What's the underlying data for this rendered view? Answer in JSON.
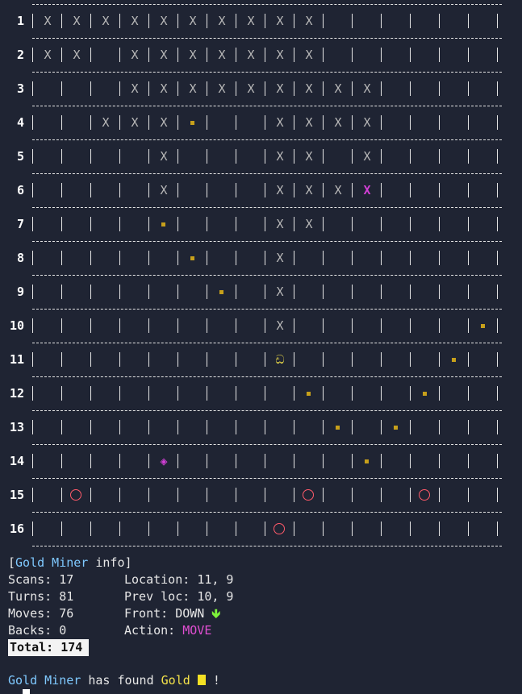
{
  "grid": {
    "rows": [
      {
        "num": "1",
        "cells": [
          "X",
          "X",
          "X",
          "X",
          "X",
          "X",
          "X",
          "X",
          "X",
          "X",
          "",
          "",
          "",
          "",
          "",
          ""
        ]
      },
      {
        "num": "2",
        "cells": [
          "X",
          "X",
          "",
          "X",
          "X",
          "X",
          "X",
          "X",
          "X",
          "X",
          "",
          "",
          "",
          "",
          "",
          ""
        ]
      },
      {
        "num": "3",
        "cells": [
          "",
          "",
          "",
          "X",
          "X",
          "X",
          "X",
          "X",
          "X",
          "X",
          "X",
          "X",
          "",
          "",
          "",
          ""
        ]
      },
      {
        "num": "4",
        "cells": [
          "",
          "",
          "X",
          "X",
          "X",
          "",
          "",
          "",
          "X",
          "X",
          "X",
          "X",
          "",
          "",
          "",
          ""
        ]
      },
      {
        "num": "5",
        "cells": [
          "",
          "",
          "",
          "",
          "X",
          "",
          "",
          "",
          "X",
          "X",
          "",
          "X",
          "",
          "",
          "",
          ""
        ]
      },
      {
        "num": "6",
        "cells": [
          "",
          "",
          "",
          "",
          "X",
          "",
          "",
          "",
          "X",
          "X",
          "X",
          "X*",
          "",
          "",
          "",
          ""
        ]
      },
      {
        "num": "7",
        "cells": [
          "",
          "",
          "",
          "",
          "",
          "",
          "",
          "",
          "X",
          "X",
          "",
          "",
          "",
          "",
          "",
          ""
        ]
      },
      {
        "num": "8",
        "cells": [
          "",
          "",
          "",
          "",
          "",
          "",
          "",
          "",
          "X",
          "",
          "",
          "",
          "",
          "",
          "",
          ""
        ]
      },
      {
        "num": "9",
        "cells": [
          "",
          "",
          "",
          "",
          "",
          "",
          "",
          "",
          "X",
          "",
          "",
          "",
          "",
          "",
          "",
          ""
        ]
      },
      {
        "num": "10",
        "cells": [
          "",
          "",
          "",
          "",
          "",
          "",
          "",
          "",
          "X",
          "",
          "",
          "",
          "",
          "",
          "",
          ""
        ]
      },
      {
        "num": "11",
        "cells": [
          "",
          "",
          "",
          "",
          "",
          "",
          "",
          "",
          "ඩ",
          "",
          "",
          "",
          "",
          "",
          "",
          ""
        ]
      },
      {
        "num": "12",
        "cells": [
          "",
          "",
          "",
          "",
          "",
          "",
          "",
          "",
          "",
          "",
          "",
          "",
          "",
          "",
          "",
          ""
        ]
      },
      {
        "num": "13",
        "cells": [
          "",
          "",
          "",
          "",
          "",
          "",
          "",
          "",
          "",
          "",
          "",
          "",
          "",
          "",
          "",
          ""
        ]
      },
      {
        "num": "14",
        "cells": [
          "",
          "",
          "",
          "",
          "◈",
          "",
          "",
          "",
          "",
          "",
          "",
          "",
          "",
          "",
          "",
          ""
        ]
      },
      {
        "num": "15",
        "cells": [
          "",
          "",
          "",
          "",
          "",
          "",
          "",
          "",
          "",
          "",
          "",
          "",
          "",
          "",
          "",
          ""
        ]
      },
      {
        "num": "16",
        "cells": [
          "",
          "",
          "",
          "",
          "",
          "",
          "",
          "",
          "",
          "",
          "",
          "",
          "",
          "",
          "",
          ""
        ]
      }
    ],
    "gold_dots": [
      [
        4,
        6
      ],
      [
        7,
        5
      ],
      [
        8,
        6
      ],
      [
        9,
        7
      ],
      [
        10,
        16
      ],
      [
        11,
        15
      ],
      [
        12,
        10
      ],
      [
        12,
        14
      ],
      [
        13,
        11
      ],
      [
        13,
        13
      ],
      [
        14,
        12
      ]
    ],
    "pits": [
      [
        15,
        2
      ],
      [
        15,
        10
      ],
      [
        15,
        14
      ],
      [
        16,
        9
      ]
    ],
    "colors": {
      "background": "#1f2433",
      "x": "#b8b8b8",
      "x_alt": "#d23fd6",
      "gold": "#c7a01b",
      "pit": "#ff5a6a",
      "miner": "#f4e24a"
    }
  },
  "info": {
    "open": "[",
    "name": "Gold Miner",
    "close": " info]",
    "scans_label": "Scans:",
    "scans": "17",
    "turns_label": "Turns:",
    "turns": "81",
    "moves_label": "Moves:",
    "moves": "76",
    "backs_label": "Backs:",
    "backs": "0",
    "total": "Total: 174",
    "location_label": "Location:",
    "location": "11, 9",
    "prev_label": "Prev loc:",
    "prev": "10, 9",
    "front_label": "Front:",
    "front": "DOWN",
    "front_icon": "arrow-down-icon",
    "action_label": "Action:",
    "action": "MOVE"
  },
  "found": {
    "name": "Gold Miner",
    "mid": " has found ",
    "gold": "Gold",
    "end": " !"
  }
}
